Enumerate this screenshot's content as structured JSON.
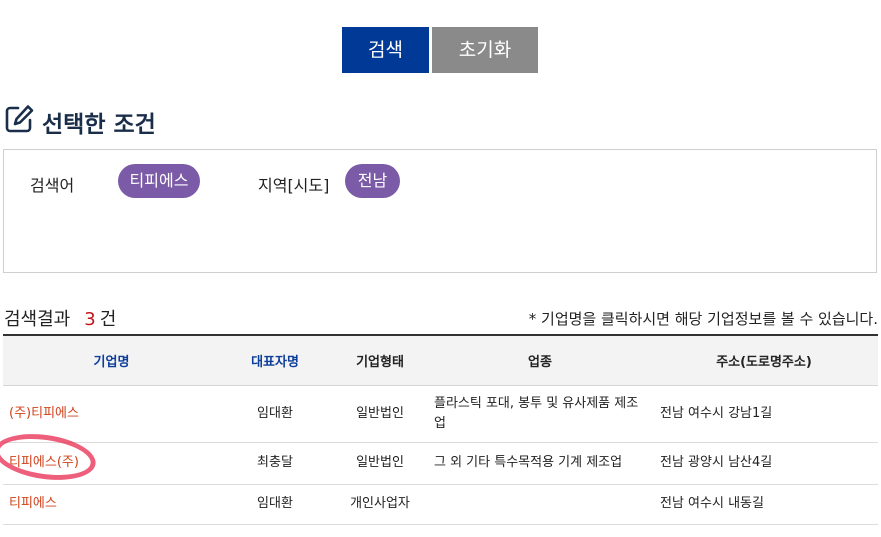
{
  "buttons": {
    "search": "검색",
    "reset": "초기화"
  },
  "section_title": "선택한 조건",
  "conditions": [
    {
      "label": "검색어",
      "value": "티피에스"
    },
    {
      "label": "지역[시도]",
      "value": "전남"
    }
  ],
  "results": {
    "label": "검색결과",
    "count": "3",
    "unit": "건",
    "notice": "*  기업명을 클릭하시면 해당 기업정보를 볼 수 있습니다."
  },
  "table": {
    "headers": [
      "기업명",
      "대표자명",
      "기업형태",
      "업종",
      "주소(도로명주소)"
    ],
    "rows": [
      [
        "(주)티피에스",
        "임대환",
        "일반법인",
        "플라스틱 포대, 봉투 및 유사제품 제조업",
        "전남 여수시 강남1길"
      ],
      [
        "티피에스(주)",
        "최충달",
        "일반법인",
        "그 외 기타 특수목적용 기계 제조업",
        "전남 광양시 남산4길"
      ],
      [
        "티피에스",
        "임대환",
        "개인사업자",
        "",
        "전남 여수시 내동길"
      ]
    ]
  },
  "colors": {
    "search_button": "#003a96",
    "reset_button": "#8a8a8a",
    "chip": "#7b5ba7",
    "company_link": "#d0421b",
    "count": "#c0161b",
    "header_blue": "#0d3e9a"
  }
}
